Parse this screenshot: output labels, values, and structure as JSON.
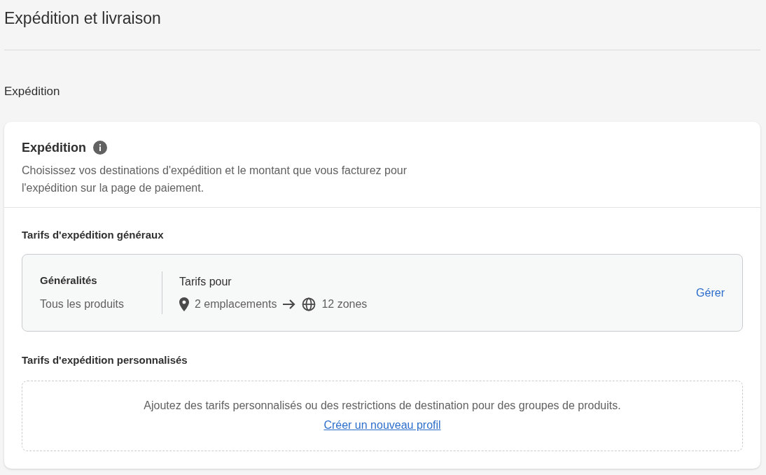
{
  "page": {
    "title": "Expédition et livraison"
  },
  "section": {
    "title": "Expédition"
  },
  "card": {
    "title": "Expédition",
    "description": "Choisissez vos destinations d'expédition et le montant que vous facturez pour l'expédition sur la page de paiement.",
    "general": {
      "heading": "Tarifs d'expédition généraux",
      "profile_name": "Généralités",
      "profile_scope": "Tous les produits",
      "rates_label": "Tarifs pour",
      "locations": "2 emplacements",
      "zones": "12 zones",
      "action": "Gérer"
    },
    "custom": {
      "heading": "Tarifs d'expédition personnalisés",
      "message": "Ajoutez des tarifs personnalisés ou des restrictions de destination pour des groupes de produits.",
      "link": "Créer un nouveau profil"
    }
  }
}
